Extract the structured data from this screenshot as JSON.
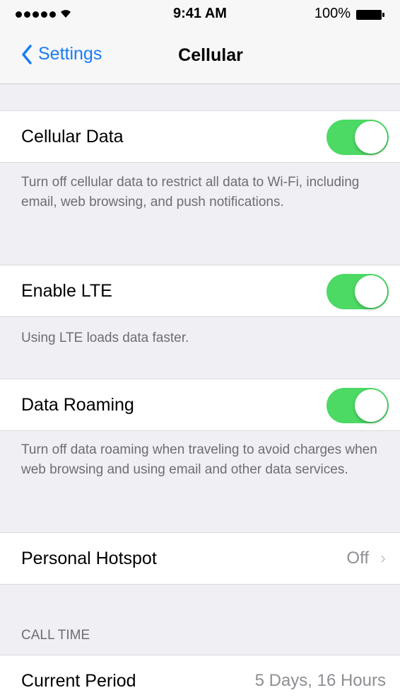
{
  "status_bar": {
    "time": "9:41 AM",
    "battery": "100%"
  },
  "nav": {
    "back_label": "Settings",
    "title": "Cellular"
  },
  "rows": {
    "cellular_data": {
      "label": "Cellular Data",
      "on": true
    },
    "cellular_data_note": "Turn off cellular data to restrict all data to Wi-Fi, including email, web browsing, and push notifications.",
    "enable_lte": {
      "label": "Enable LTE",
      "on": true
    },
    "enable_lte_note": "Using LTE loads data faster.",
    "data_roaming": {
      "label": "Data Roaming",
      "on": true
    },
    "data_roaming_note": "Turn off data roaming when traveling to avoid charges when web browsing and using email and other data services.",
    "personal_hotspot": {
      "label": "Personal Hotspot",
      "value": "Off"
    }
  },
  "call_time": {
    "header": "CALL TIME",
    "current_period": {
      "label": "Current Period",
      "value": "5 Days, 16 Hours"
    }
  },
  "colors": {
    "accent": "#1a7cf5",
    "toggle_on": "#4cd964",
    "background": "#efeff4"
  },
  "icons": {
    "back": "chevron-left-icon",
    "disclosure": "chevron-right-icon",
    "signal": "signal-dots-icon",
    "wifi": "wifi-icon",
    "battery": "battery-icon"
  }
}
